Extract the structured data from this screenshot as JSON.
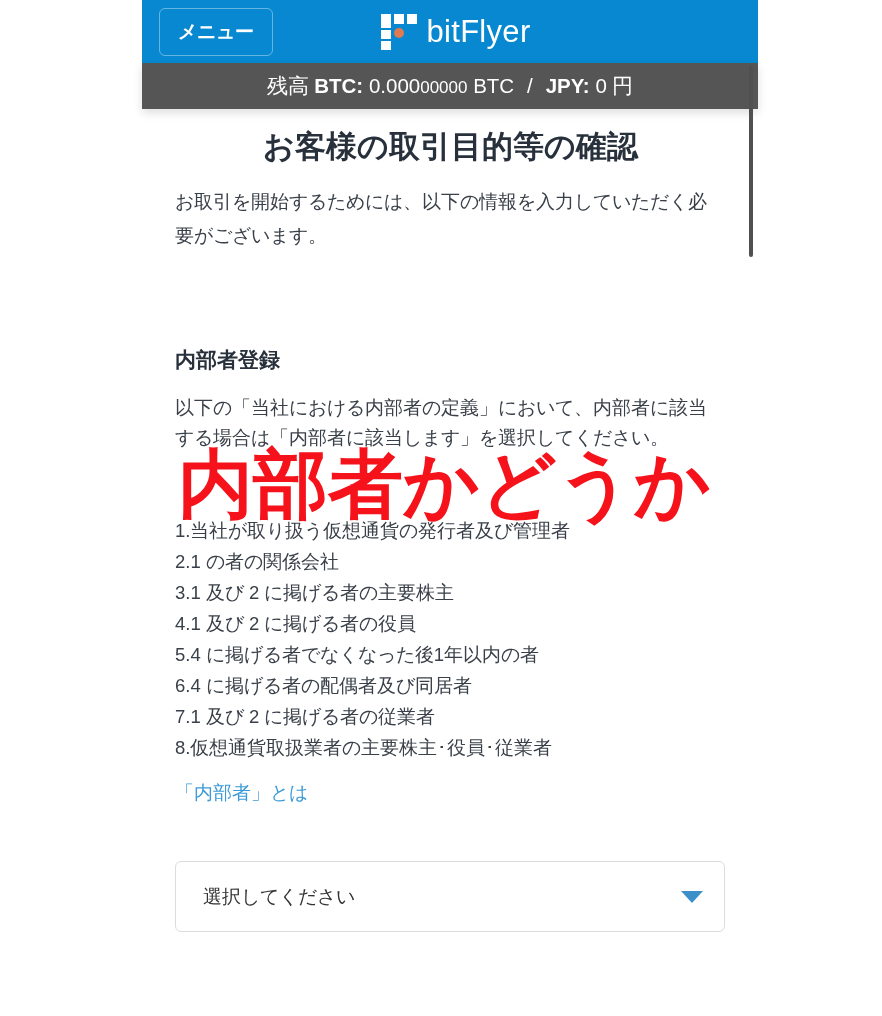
{
  "header": {
    "menu_button": "メニュー",
    "brand": "bitFlyer"
  },
  "balance_bar": {
    "label": "残高",
    "btc_label": "BTC:",
    "btc_amount": "0.000",
    "btc_amount_small": "00000",
    "btc_unit": "BTC",
    "separator": "/",
    "jpy_label": "JPY:",
    "jpy_amount": "0",
    "jpy_unit": "円"
  },
  "page": {
    "title": "お客様の取引目的等の確認",
    "intro": "お取引を開始するためには、以下の情報を入力していただく必要がございます。"
  },
  "insider_section": {
    "heading": "内部者登録",
    "instruction": "以下の「当社における内部者の定義」において、内部者に該当する場合は「内部者に該当します」を選択してください。",
    "definitions": [
      "1.当社が取り扱う仮想通貨の発行者及び管理者",
      "2.1 の者の関係会社",
      "3.1 及び 2 に掲げる者の主要株主",
      "4.1 及び 2 に掲げる者の役員",
      "5.4 に掲げる者でなくなった後1年以内の者",
      "6.4 に掲げる者の配偶者及び同居者",
      "7.1 及び 2 に掲げる者の従業者",
      "8.仮想通貨取扱業者の主要株主･役員･従業者"
    ],
    "link": "「内部者」とは",
    "select": {
      "placeholder": "選択してください"
    }
  },
  "annotation": "内部者かどうか"
}
